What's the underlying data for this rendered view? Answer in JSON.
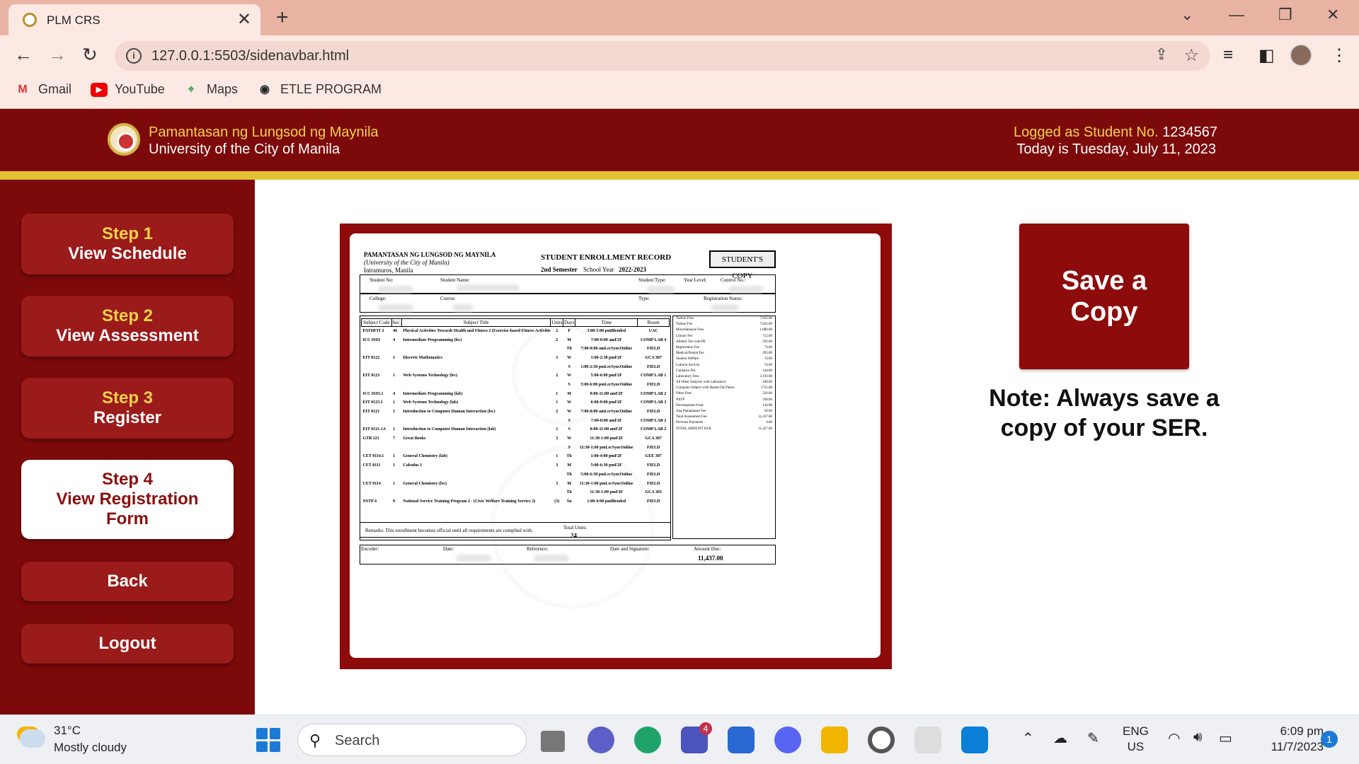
{
  "browser": {
    "tab_title": "PLM CRS",
    "url": "127.0.0.1:5503/sidenavbar.html",
    "bookmarks": [
      {
        "label": "Gmail",
        "icon": "gmail-icon"
      },
      {
        "label": "YouTube",
        "icon": "youtube-icon"
      },
      {
        "label": "Maps",
        "icon": "maps-icon"
      },
      {
        "label": "ETLE PROGRAM",
        "icon": "globe-icon"
      }
    ]
  },
  "header": {
    "uni_name": "Pamantasan ng Lungsod ng Maynila",
    "uni_name_en": "University of the City of Manila",
    "logged_label": "Logged as Student No.",
    "student_no": "1234567",
    "today": "Today is Tuesday, July 11, 2023"
  },
  "sidebar": {
    "step1_num": "Step 1",
    "step1_label": "View Schedule",
    "step2_num": "Step 2",
    "step2_label": "View Assessment",
    "step3_num": "Step 3",
    "step3_label": "Register",
    "step4_num": "Step 4",
    "step4_label": "View Registration Form",
    "back": "Back",
    "logout": "Logout"
  },
  "main": {
    "save_copy": "Save a Copy",
    "note": "Note: Always save a copy of your SER."
  },
  "ser": {
    "school": "PAMANTASAN NG LUNGSOD NG MAYNILA",
    "school_sub": "(University of the City of Manila)",
    "location": "Intramuros, Manila",
    "title": "STUDENT ENROLLMENT RECORD",
    "semester": "2nd Semester",
    "school_year_label": "School Year",
    "school_year": "2022-2023",
    "copy": "STUDENT'S COPY",
    "student_no_label": "Student No:",
    "student_name_label": "Student Name:",
    "student_type_label": "Student Type:",
    "year_level_label": "Year Level:",
    "control_no_label": "Control No.:",
    "college_label": "College:",
    "course_label": "Course:",
    "type_label": "Type:",
    "reg_status_label": "Registration Status:",
    "headers": [
      "Subject Code",
      "Sec.",
      "Subject Title",
      "Units",
      "Days",
      "Time",
      "Room"
    ],
    "rows": [
      [
        "PATHFIT 2",
        "46",
        "Physical Activities Towards Health and Fitness 2 (Exercise-based Fitness Activities)",
        "2",
        "F",
        "3:00-5:00 pmBlended",
        "UAC"
      ],
      [
        "ICC 0103",
        "4",
        "Intermediate Programming (lec)",
        "2",
        "M",
        "7:00-8:00 amF2F",
        "COMP LAB 4"
      ],
      [
        "",
        "",
        "",
        "",
        "Th",
        "7:00-8:00 amLecSyncOnline",
        "FIELD"
      ],
      [
        "EIT 0122",
        "1",
        "Discrete Mathematics",
        "3",
        "W",
        "1:00-2:30 pmF2F",
        "GCA 307"
      ],
      [
        "",
        "",
        "",
        "",
        "S",
        "1:00-2:30 pmLecSyncOnline",
        "FIELD"
      ],
      [
        "EIT 0123",
        "1",
        "Web Systems Technology (lec)",
        "2",
        "W",
        "5:00-6:00 pmF2F",
        "COMP LAB 1"
      ],
      [
        "",
        "",
        "",
        "",
        "S",
        "5:00-6:00 pmLecSyncOnline",
        "FIELD"
      ],
      [
        "ICC 0103.1",
        "4",
        "Intermediate Programming (lab)",
        "1",
        "M",
        "8:00-11:00 amF2F",
        "COMP LAB 2"
      ],
      [
        "EIT 0123.1",
        "1",
        "Web Systems Technology (lab)",
        "1",
        "W",
        "6:00-9:00 pmF2F",
        "COMP LAB 3"
      ],
      [
        "EIT 0121",
        "1",
        "Introduction to Computer Human Interaction (lec)",
        "2",
        "W",
        "7:00-8:00 amLecSyncOnline",
        "FIELD"
      ],
      [
        "",
        "",
        "",
        "",
        "S",
        "7:00-8:00 amF2F",
        "COMP LAB 2"
      ],
      [
        "EIT 0121.1A",
        "1",
        "Introduction to Computer Human Interaction (lab)",
        "1",
        "S",
        "8:00-11:00 amF2F",
        "COMP LAB 2"
      ],
      [
        "GTB 121",
        "7",
        "Great Books",
        "3",
        "W",
        "11:30-1:00 pmF2F",
        "GCA 307"
      ],
      [
        "",
        "",
        "",
        "",
        "S",
        "11:30-1:00 pmLecSyncOnline",
        "FIELD"
      ],
      [
        "CET 0114.1",
        "1",
        "General Chemistry (lab)",
        "1",
        "Th",
        "1:00-4:00 pmF2F",
        "GEE 307"
      ],
      [
        "CET 0111",
        "1",
        "Calculus 1",
        "3",
        "M",
        "5:00-6:30 pmF2F",
        "FIELD"
      ],
      [
        "",
        "",
        "",
        "",
        "Th",
        "5:00-6:30 pmLecSyncOnline",
        "FIELD"
      ],
      [
        "CET 0114",
        "1",
        "General Chemistry (lec)",
        "3",
        "M",
        "11:30-1:00 pmLecSyncOnline",
        "FIELD"
      ],
      [
        "",
        "",
        "",
        "",
        "Th",
        "11:30-1:00 pmF2F",
        "GCA 303"
      ],
      [
        "NSTP 4",
        "9",
        "National Service Training Program 2 - (Civic Welfare Training Service 2)",
        "(3)",
        "Su",
        "1:00-4:00 pmBlended",
        "FIELD"
      ]
    ],
    "remarks": "Remarks: This enrollment becomes official until all requirements are complied with.",
    "total_units_label": "Total Units:",
    "total_units": "24",
    "fees": [
      [
        "Tuition Fees",
        "7,032.00"
      ],
      [
        "Tuition Fee",
        "7,032.00"
      ],
      [
        "Miscellaneous Fees",
        "1,686.00"
      ],
      [
        "Library Fee",
        "712.00"
      ],
      [
        "Athletic Fee with PE",
        "293.00"
      ],
      [
        "Registration Fee",
        "74.00"
      ],
      [
        "Medical/Dental Fee",
        "293.00"
      ],
      [
        "Student Welfare",
        "74.00"
      ],
      [
        "Cultural Activity",
        "74.00"
      ],
      [
        "Guidance Fee",
        "144.00"
      ],
      [
        "Laboratory Fees",
        "2,193.00"
      ],
      [
        "All Other Subjects with Laboratory",
        "438.00"
      ],
      [
        "Computer Subject with Hands-On/Thesis",
        "1755.00"
      ],
      [
        "Other Fees",
        "526.00"
      ],
      [
        "NSTP",
        "338.00"
      ],
      [
        "Development Fund",
        "144.00"
      ],
      [
        "Ang Pamantasan Fee",
        "50.00"
      ],
      [
        "Total Assessment Fee:",
        "11,437.00"
      ],
      [
        "Previous Payments",
        "0.00"
      ],
      [
        "TOTAL AMOUNT DUE",
        "11,437.00"
      ]
    ],
    "encoder_label": "Encoder:",
    "date_label": "Date:",
    "reference_label": "Reference:",
    "sign_label": "Date and Signature:",
    "amount_due_label": "Amount Due:",
    "amount_due": "11,437.00"
  },
  "taskbar": {
    "temp": "31°C",
    "weather": "Mostly cloudy",
    "search": "Search",
    "lang1": "ENG",
    "lang2": "US",
    "time": "6:09 pm",
    "date": "11/7/2023",
    "notif_count": "1",
    "teams_badge": "4"
  }
}
